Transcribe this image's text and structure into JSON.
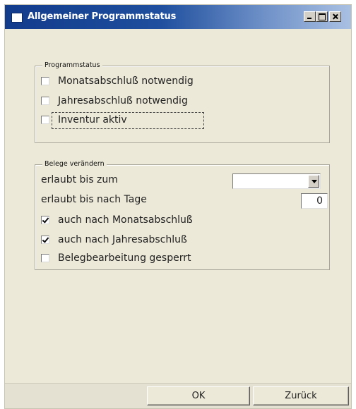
{
  "window": {
    "title": "Allgemeiner Programmstatus",
    "controls": [
      "minimize",
      "maximize",
      "close"
    ]
  },
  "programmstatus": {
    "legend": "Programmstatus",
    "items": [
      {
        "label": "Monatsabschluß notwendig",
        "checked": false
      },
      {
        "label": "Jahresabschluß notwendig",
        "checked": false
      },
      {
        "label": "Inventur aktiv",
        "checked": false,
        "focused": true
      }
    ]
  },
  "belege": {
    "legend": "Belege verändern",
    "erlaubt_bis_zum_label": "erlaubt bis zum",
    "erlaubt_bis_zum_value": "",
    "erlaubt_bis_nach_tage_label": "erlaubt bis nach Tage",
    "erlaubt_bis_nach_tage_value": "0",
    "items": [
      {
        "label": "auch nach Monatsabschluß",
        "checked": true
      },
      {
        "label": "auch nach Jahresabschluß",
        "checked": true
      },
      {
        "label": "Belegbearbeitung gesperrt",
        "checked": false
      }
    ]
  },
  "buttons": {
    "ok": "OK",
    "back": "Zurück"
  }
}
